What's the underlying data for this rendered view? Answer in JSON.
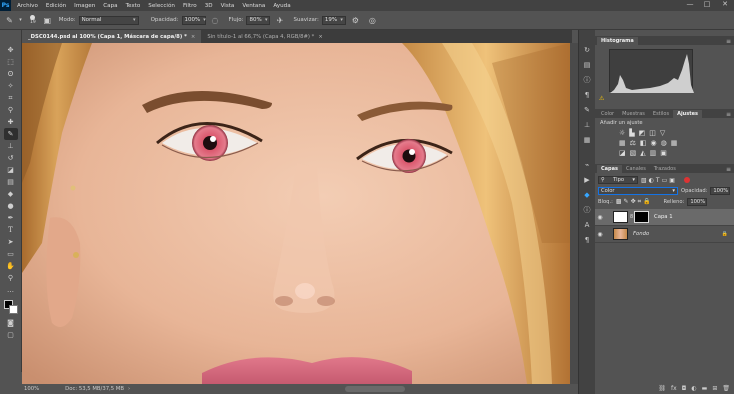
{
  "app": {
    "logo": "Ps"
  },
  "menu": [
    "Archivo",
    "Edición",
    "Imagen",
    "Capa",
    "Texto",
    "Selección",
    "Filtro",
    "3D",
    "Vista",
    "Ventana",
    "Ayuda"
  ],
  "window_controls": {
    "minimize": "—",
    "maximize": "□",
    "close": "✕"
  },
  "options": {
    "brush_size": "19",
    "mode_label": "Modo:",
    "mode_value": "Normal",
    "opacity_label": "Opacidad:",
    "opacity_value": "100%",
    "flow_label": "Flujo:",
    "flow_value": "80%",
    "smoothing_label": "Suavizar:",
    "smoothing_value": "19%"
  },
  "tabs": [
    {
      "label": "_DSC0144.psd al 100% (Capa 1, Máscara de capa/8) *",
      "close": "×"
    },
    {
      "label": "Sin título-1 al 66,7% (Capa 4, RGB/8#) *",
      "close": "×"
    }
  ],
  "status": {
    "zoom": "100%",
    "doc": "Doc: 53,5 MB/37,5 MB"
  },
  "histogram": {
    "title": "Histograma"
  },
  "adjust_tabs": [
    "Color",
    "Muestras",
    "Estilos",
    "Ajustes"
  ],
  "adjust_title": "Añadir un ajuste",
  "layers": {
    "tabs": [
      "Capas",
      "Canales",
      "Trazados"
    ],
    "filter_value": "Tipo",
    "blend_mode": "Color",
    "opacity_label": "Opacidad:",
    "opacity_value": "100%",
    "lock_label": "Bloq.:",
    "fill_label": "Relleno:",
    "fill_value": "100%",
    "items": [
      {
        "name": "Capa 1",
        "selected": true
      },
      {
        "name": "Fondo",
        "selected": false
      }
    ]
  }
}
